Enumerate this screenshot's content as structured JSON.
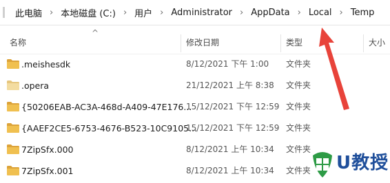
{
  "address_bar": {
    "breadcrumbs": [
      "此电脑",
      "本地磁盘 (C:)",
      "用户",
      "Administrator",
      "AppData",
      "Local",
      "Temp"
    ],
    "separator": "›"
  },
  "columns": {
    "name": "名称",
    "date_modified": "修改日期",
    "type": "类型",
    "size": "大小",
    "sort_indicator": "^"
  },
  "files": [
    {
      "name": ".meishesdk",
      "date": "8/12/2021 下午 1:00",
      "type": "文件夹",
      "icon": "folder-icon"
    },
    {
      "name": ".opera",
      "date": "21/12/2021 上午 8:38",
      "type": "文件夹",
      "icon": "folder-icon-light"
    },
    {
      "name": "{50206EAB-AC3A-468d-A409-47E176...",
      "date": "15/12/2021 下午 12:59",
      "type": "文件夹",
      "icon": "folder-icon"
    },
    {
      "name": "{AAEF2CE5-6753-4676-B523-10C9105...",
      "date": "15/12/2021 下午 12:59",
      "type": "文件夹",
      "icon": "folder-icon"
    },
    {
      "name": "7ZipSfx.000",
      "date": "8/12/2021 上午 10:34",
      "type": "文件夹",
      "icon": "folder-icon"
    },
    {
      "name": "7ZipSfx.001",
      "date": "8/12/2021 上午 10:34",
      "type": "文件夹",
      "icon": "folder-icon"
    }
  ],
  "watermark": {
    "text": "U教授"
  },
  "colors": {
    "folder": "#e8b84a",
    "folder_light": "#f1d48e",
    "arrow": "#e8433a",
    "watermark_blue": "#1f4f9b",
    "watermark_green": "#2e9b46"
  }
}
